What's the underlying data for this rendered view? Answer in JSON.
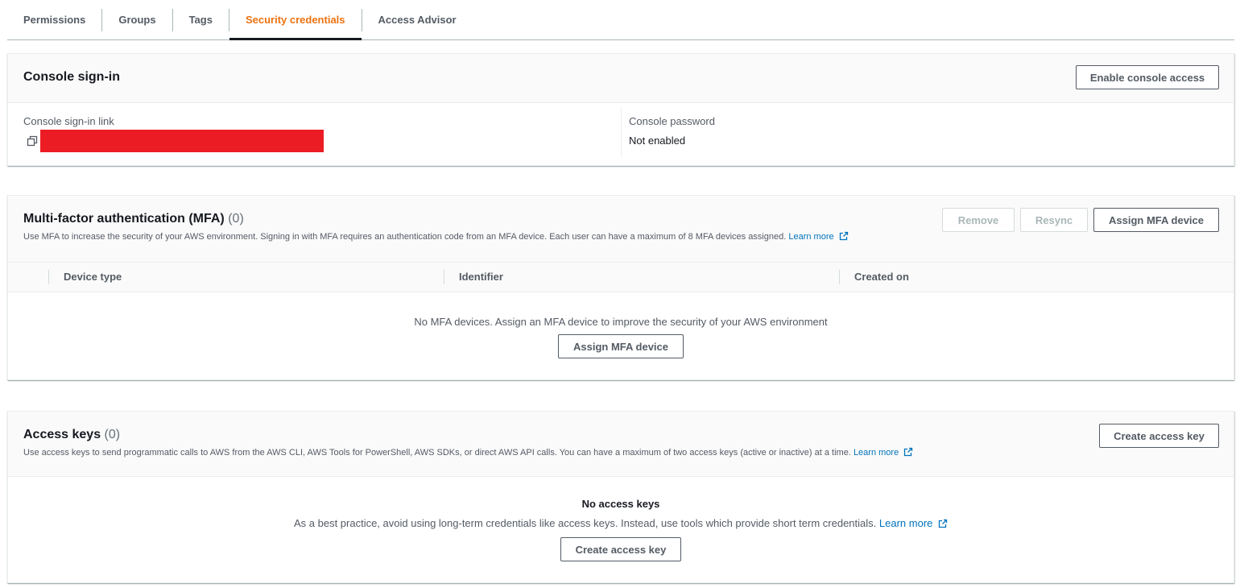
{
  "tabs": [
    {
      "label": "Permissions"
    },
    {
      "label": "Groups"
    },
    {
      "label": "Tags"
    },
    {
      "label": "Security credentials"
    },
    {
      "label": "Access Advisor"
    }
  ],
  "console_signin": {
    "title": "Console sign-in",
    "enable_button": "Enable console access",
    "link_label": "Console sign-in link",
    "password_label": "Console password",
    "password_value": "Not enabled"
  },
  "mfa": {
    "title": "Multi-factor authentication (MFA)",
    "count": "(0)",
    "description": "Use MFA to increase the security of your AWS environment. Signing in with MFA requires an authentication code from an MFA device. Each user can have a maximum of 8 MFA devices assigned.",
    "learn_more": "Learn more",
    "remove_button": "Remove",
    "resync_button": "Resync",
    "assign_button": "Assign MFA device",
    "columns": [
      "Device type",
      "Identifier",
      "Created on"
    ],
    "empty_message": "No MFA devices. Assign an MFA device to improve the security of your AWS environment",
    "empty_assign_button": "Assign MFA device"
  },
  "access_keys": {
    "title": "Access keys",
    "count": "(0)",
    "description": "Use access keys to send programmatic calls to AWS from the AWS CLI, AWS Tools for PowerShell, AWS SDKs, or direct AWS API calls. You can have a maximum of two access keys (active or inactive) at a time.",
    "learn_more": "Learn more",
    "create_button": "Create access key",
    "empty_title": "No access keys",
    "empty_message": "As a best practice, avoid using long-term credentials like access keys. Instead, use tools which provide short term credentials.",
    "empty_learn_more": "Learn more",
    "empty_create_button": "Create access key"
  },
  "colors": {
    "active_tab": "#ec7211",
    "link": "#0073bb",
    "redaction": "#ec1c24"
  }
}
